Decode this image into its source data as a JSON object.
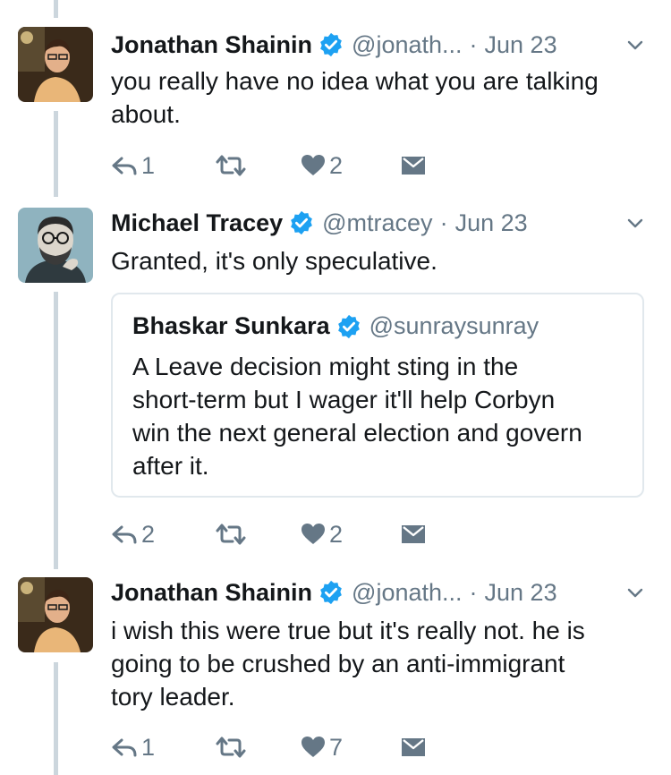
{
  "tweets": [
    {
      "name": "Jonathan Shainin",
      "handle": "@jonath...",
      "date": "Jun 23",
      "text": "you really have no idea what you are talking\nabout.",
      "replies": "1",
      "likes": "2"
    },
    {
      "name": "Michael Tracey",
      "handle": "@mtracey",
      "date": "Jun 23",
      "text": "Granted, it's only speculative.",
      "quote": {
        "name": "Bhaskar Sunkara",
        "handle": "@sunraysunray",
        "text": "A Leave decision might sting in the\nshort-term but I wager it'll help Corbyn\nwin the next general election and govern\nafter it."
      },
      "replies": "2",
      "likes": "2"
    },
    {
      "name": "Jonathan Shainin",
      "handle": "@jonath...",
      "date": "Jun 23",
      "text": "i wish this were true but it's really not. he is\ngoing to be crushed by an anti-immigrant\ntory leader.",
      "replies": "1",
      "likes": "7"
    }
  ],
  "separator": "·",
  "colors": {
    "verified": "#1da1f2",
    "muted": "#657786",
    "thread_line": "#ccd6dd",
    "border": "#e1e8ed"
  },
  "icons": [
    "reply-icon",
    "retweet-icon",
    "like-icon",
    "direct-message-icon",
    "chevron-down-icon",
    "verified-badge-icon"
  ]
}
